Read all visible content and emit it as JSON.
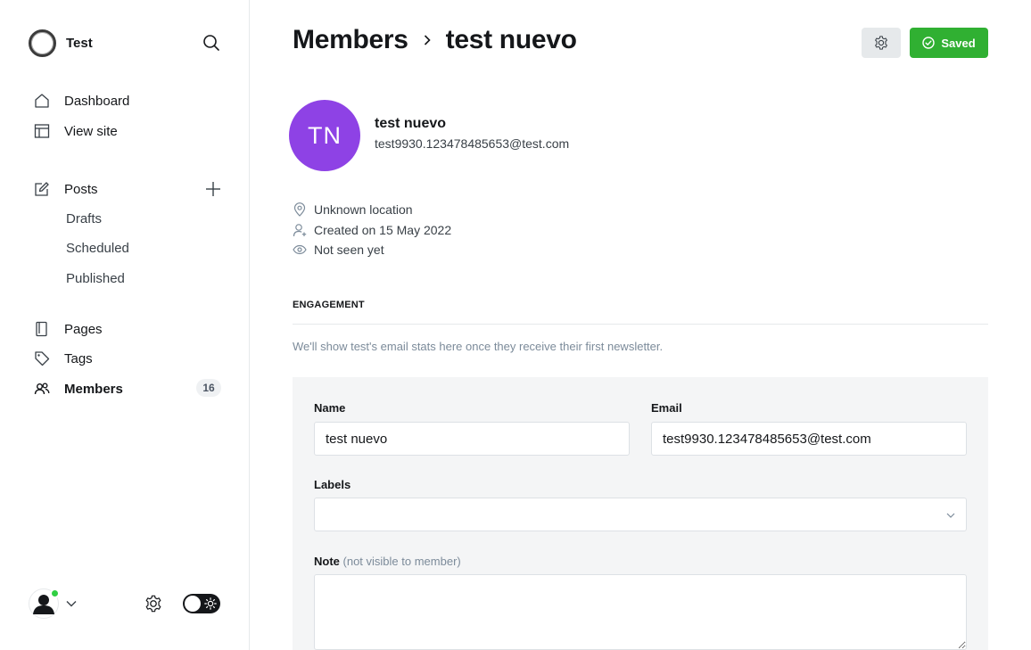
{
  "sidebar": {
    "site_name": "Test",
    "nav": {
      "dashboard": "Dashboard",
      "view_site": "View site",
      "posts": "Posts",
      "drafts": "Drafts",
      "scheduled": "Scheduled",
      "published": "Published",
      "pages": "Pages",
      "tags": "Tags",
      "members": "Members",
      "members_count": "16"
    }
  },
  "header": {
    "breadcrumb_parent": "Members",
    "breadcrumb_current": "test nuevo",
    "saved_label": "Saved"
  },
  "member": {
    "initials": "TN",
    "name": "test nuevo",
    "email": "test9930.123478485653@test.com",
    "location": "Unknown location",
    "created": "Created on 15 May 2022",
    "last_seen": "Not seen yet"
  },
  "engagement": {
    "heading": "ENGAGEMENT",
    "note": "We'll show test's email stats here once they receive their first newsletter."
  },
  "form": {
    "name_label": "Name",
    "name_value": "test nuevo",
    "email_label": "Email",
    "email_value": "test9930.123478485653@test.com",
    "labels_label": "Labels",
    "note_label": "Note",
    "note_hint": "(not visible to member)"
  },
  "colors": {
    "accent_green": "#30b032",
    "avatar_purple": "#8e42e5",
    "online_green": "#30cf43"
  }
}
